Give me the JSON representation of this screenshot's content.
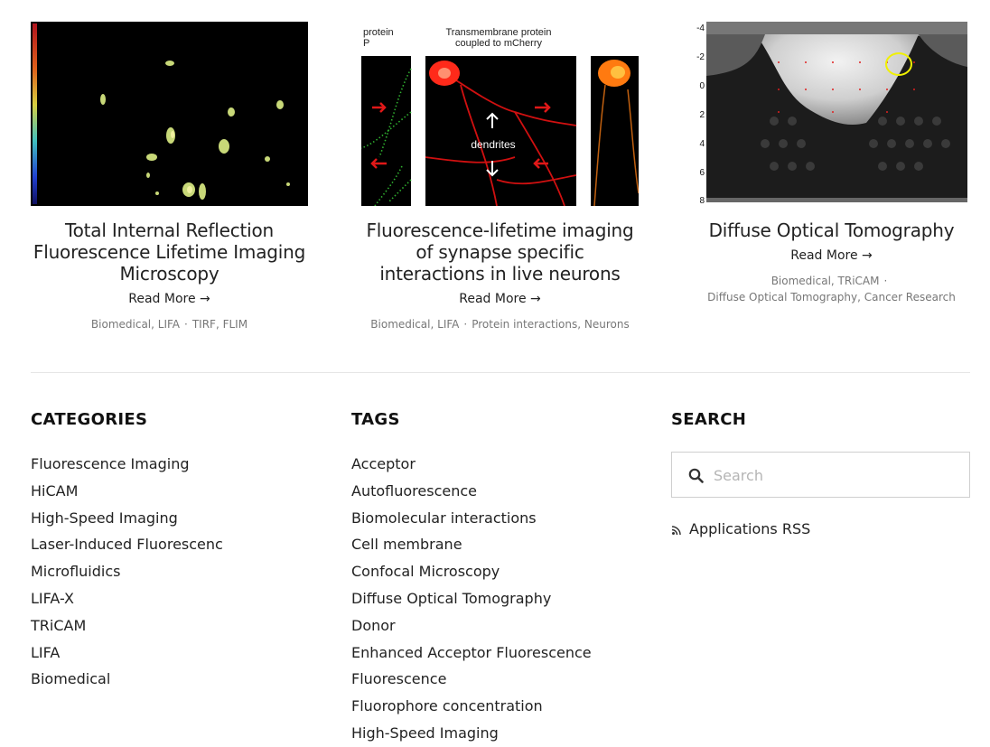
{
  "cards": [
    {
      "title": "Total Internal Reflection Fluorescence Lifetime Imaging Microscopy",
      "read_more": "Read More →",
      "categories": "Biomedical, LIFA",
      "tags": "TIRF, FLIM"
    },
    {
      "title": "Fluorescence-lifetime imaging of synapse specific interactions in live neurons",
      "read_more": "Read More →",
      "categories": "Biomedical, LIFA",
      "tags": "Protein interactions, Neurons",
      "image_labels": {
        "left_header": "protein",
        "left_header2": "P",
        "center_header": "Transmembrane protein",
        "center_header2": "coupled to mCherry",
        "center_label": "dendrites"
      }
    },
    {
      "title": "Diffuse Optical Tomography",
      "read_more": "Read More →",
      "categories": "Biomedical, TRiCAM",
      "tags": "Diffuse Optical Tomography, Cancer Research",
      "axis_ticks": [
        "-4",
        "-2",
        "0",
        "2",
        "4",
        "6",
        "8"
      ]
    }
  ],
  "categories": {
    "heading": "CATEGORIES",
    "items": [
      "Fluorescence Imaging",
      "HiCAM",
      "High-Speed Imaging",
      "Laser-Induced Fluorescenc",
      "Microfluidics",
      "LIFA-X",
      "TRiCAM",
      "LIFA",
      "Biomedical"
    ]
  },
  "tags": {
    "heading": "TAGS",
    "items": [
      "Acceptor",
      "Autofluorescence",
      "Biomolecular interactions",
      "Cell membrane",
      "Confocal Microscopy",
      "Diffuse Optical Tomography",
      "Donor",
      "Enhanced Acceptor Fluorescence",
      "Fluorescence",
      "Fluorophore concentration",
      "High-Speed Imaging"
    ]
  },
  "search": {
    "heading": "SEARCH",
    "placeholder": "Search",
    "rss_label": "Applications RSS"
  }
}
